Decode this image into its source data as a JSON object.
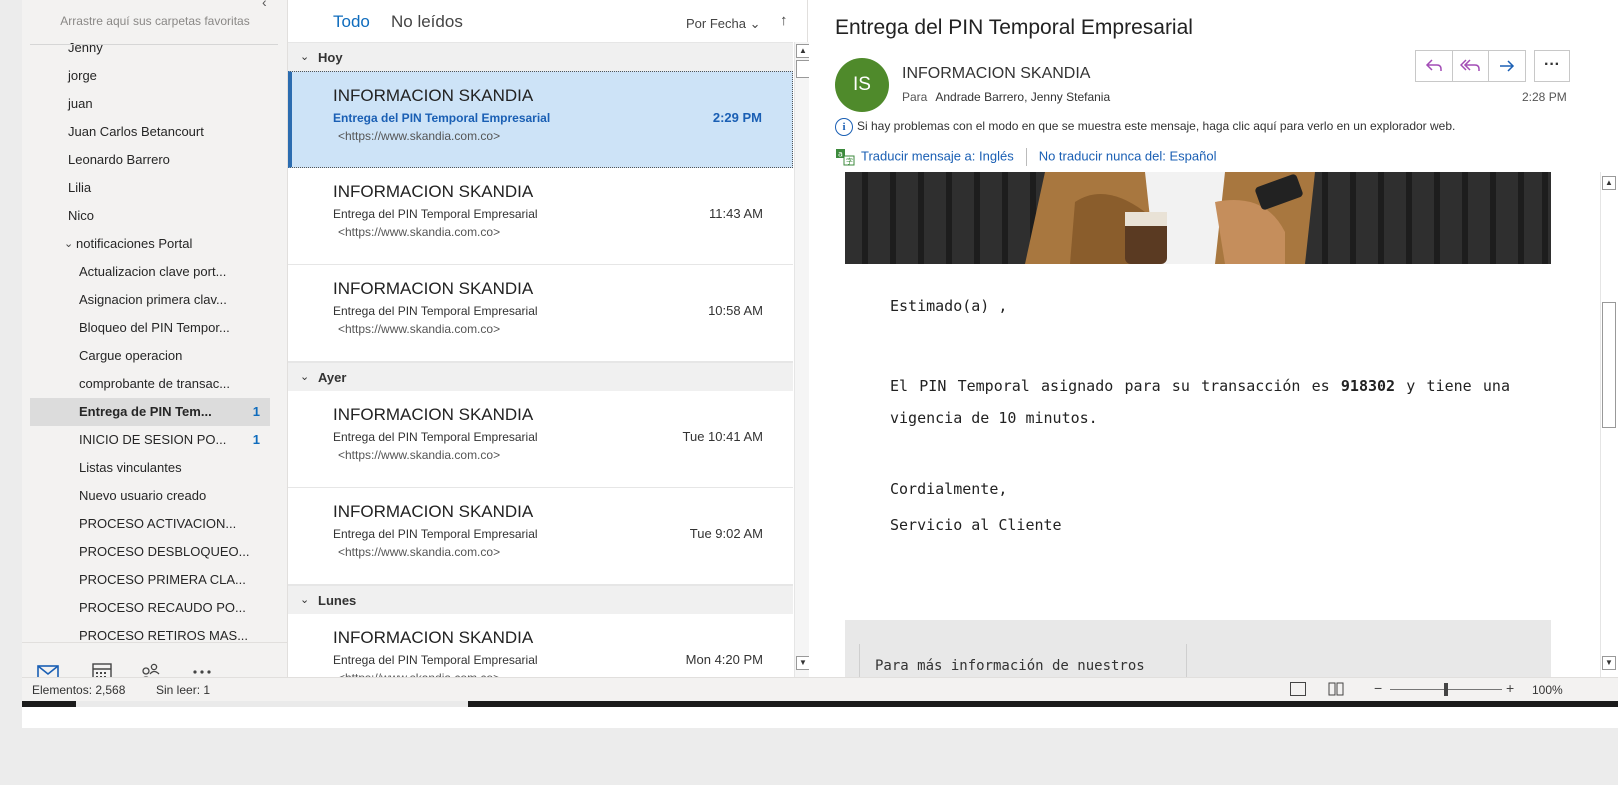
{
  "folders_pane": {
    "collapse_icon": "chevron-left-icon",
    "favorites_hint": "Arrastre aquí sus carpetas favoritas",
    "folders": [
      {
        "label": "Jenny",
        "type": "top",
        "count": ""
      },
      {
        "label": "jorge",
        "type": "top",
        "count": ""
      },
      {
        "label": "juan",
        "type": "top",
        "count": ""
      },
      {
        "label": "Juan Carlos Betancourt",
        "type": "top",
        "count": ""
      },
      {
        "label": "Leonardo Barrero",
        "type": "top",
        "count": ""
      },
      {
        "label": "Lilia",
        "type": "top",
        "count": ""
      },
      {
        "label": "Nico",
        "type": "top",
        "count": ""
      },
      {
        "label": "notificaciones Portal",
        "type": "parent",
        "count": ""
      },
      {
        "label": "Actualizacion clave port...",
        "type": "sub",
        "count": ""
      },
      {
        "label": "Asignacion primera clav...",
        "type": "sub",
        "count": ""
      },
      {
        "label": "Bloqueo del PIN Tempor...",
        "type": "sub",
        "count": ""
      },
      {
        "label": "Cargue operacion",
        "type": "sub",
        "count": ""
      },
      {
        "label": "comprobante de transac...",
        "type": "sub",
        "count": ""
      },
      {
        "label": "Entrega de PIN Tem...",
        "type": "sub",
        "count": "1",
        "selected": true
      },
      {
        "label": "INICIO DE SESION PO...",
        "type": "sub",
        "count": "1"
      },
      {
        "label": "Listas vinculantes",
        "type": "sub",
        "count": ""
      },
      {
        "label": "Nuevo usuario creado",
        "type": "sub",
        "count": ""
      },
      {
        "label": "PROCESO ACTIVACION...",
        "type": "sub",
        "count": ""
      },
      {
        "label": "PROCESO DESBLOQUEO...",
        "type": "sub",
        "count": ""
      },
      {
        "label": "PROCESO PRIMERA CLA...",
        "type": "sub",
        "count": ""
      },
      {
        "label": "PROCESO RECAUDO PO...",
        "type": "sub",
        "count": ""
      },
      {
        "label": "PROCESO RETIROS MAS...",
        "type": "sub",
        "count": ""
      }
    ],
    "nav_icons": [
      "mail-icon",
      "calendar-icon",
      "people-icon",
      "more-icon"
    ]
  },
  "message_list": {
    "tab_all": "Todo",
    "tab_unread": "No leídos",
    "sort_label": "Por Fecha",
    "sort_direction_icon": "arrow-up-icon",
    "groups": [
      {
        "label": "Hoy",
        "messages": [
          {
            "sender": "INFORMACION SKANDIA",
            "subject": "Entrega del PIN Temporal Empresarial",
            "preview": "<https://www.skandia.com.co>",
            "time": "2:29 PM",
            "selected": true
          },
          {
            "sender": "INFORMACION SKANDIA",
            "subject": "Entrega del PIN Temporal Empresarial",
            "preview": "<https://www.skandia.com.co>",
            "time": "11:43 AM"
          },
          {
            "sender": "INFORMACION SKANDIA",
            "subject": "Entrega del PIN Temporal Empresarial",
            "preview": "<https://www.skandia.com.co>",
            "time": "10:58 AM"
          }
        ]
      },
      {
        "label": "Ayer",
        "messages": [
          {
            "sender": "INFORMACION SKANDIA",
            "subject": "Entrega del PIN Temporal Empresarial",
            "preview": "<https://www.skandia.com.co>",
            "time": "Tue 10:41 AM"
          },
          {
            "sender": "INFORMACION SKANDIA",
            "subject": "Entrega del PIN Temporal Empresarial",
            "preview": "<https://www.skandia.com.co>",
            "time": "Tue 9:02 AM"
          }
        ]
      },
      {
        "label": "Lunes",
        "messages": [
          {
            "sender": "INFORMACION SKANDIA",
            "subject": "Entrega del PIN Temporal Empresarial",
            "preview": "<https://www.skandia.com.co>",
            "time": "Mon 4:20 PM"
          }
        ]
      }
    ]
  },
  "reading_pane": {
    "subject": "Entrega del PIN Temporal Empresarial",
    "avatar_initials": "IS",
    "avatar_color": "#4f8a2b",
    "from": "INFORMACION SKANDIA",
    "to_label": "Para",
    "to": "Andrade Barrero, Jenny Stefania",
    "time": "2:28 PM",
    "action_icons": [
      "reply-icon",
      "reply-all-icon",
      "forward-icon",
      "more-actions-icon"
    ],
    "info_text": "Si hay problemas con el modo en que se muestra este mensaje, haga clic aquí para verlo en un explorador web.",
    "translate_link": "Traducir mensaje a: Inglés",
    "never_translate_link": "No traducir nunca del: Español",
    "body": {
      "greeting": "Estimado(a) ,",
      "pin_before": "El PIN Temporal asignado para su transacción es ",
      "pin": "918302",
      "pin_after": " y tiene una vigencia de 10 minutos.",
      "closing": "Cordialmente,",
      "signature": "Servicio al Cliente",
      "footer_text": "Para más información de nuestros"
    }
  },
  "status_bar": {
    "items": "Elementos: 2,568",
    "unread": "Sin leer: 1",
    "zoom": "100%",
    "zoom_fraction": 0.5
  },
  "colors": {
    "accent": "#0f6cbd",
    "selected_row": "#cde3f7",
    "selected_border": "#2b6cb0",
    "reply_icon": "#a24cb5",
    "forward_icon": "#1a5fb4"
  }
}
